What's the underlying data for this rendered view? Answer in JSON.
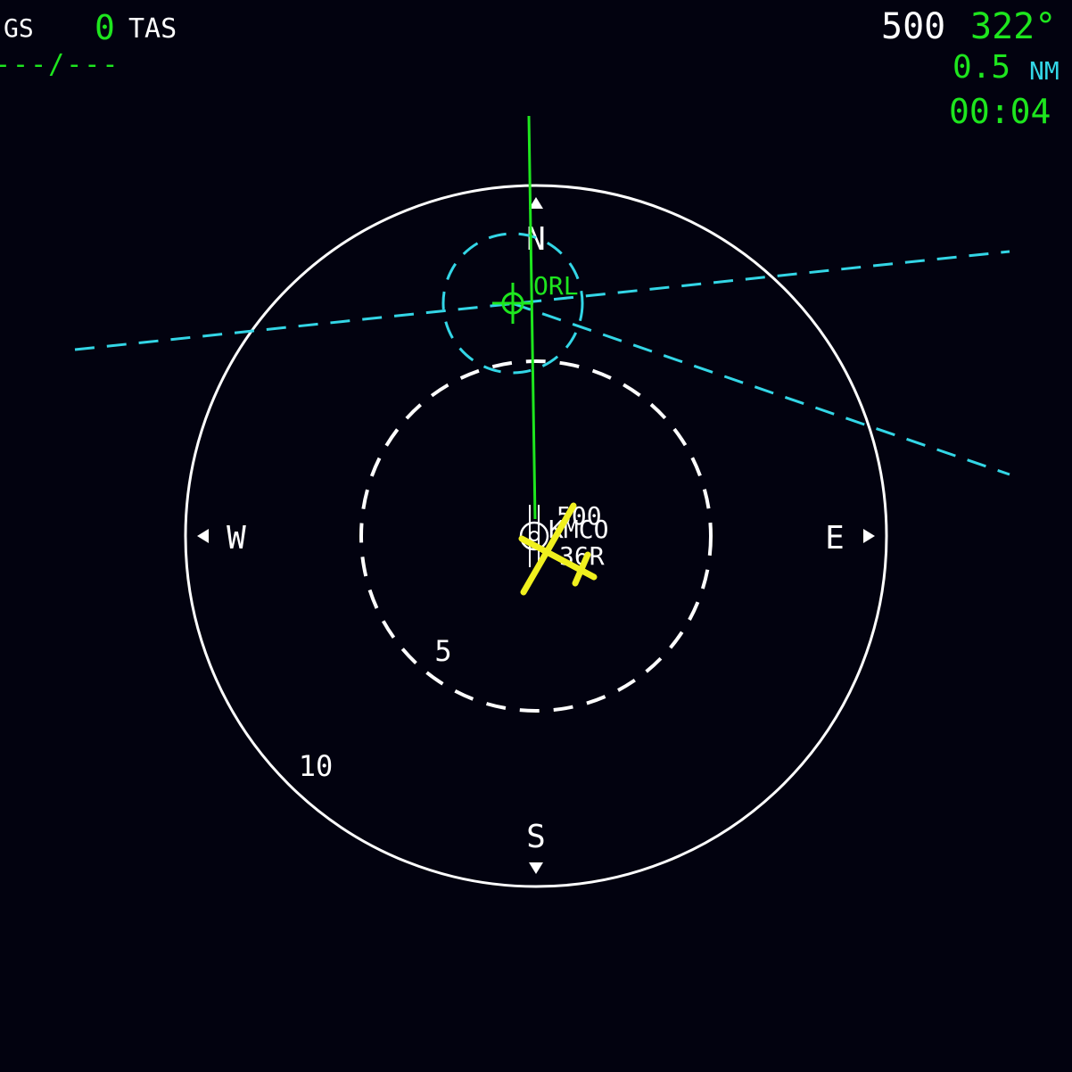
{
  "top_left": {
    "gs_label": "GS",
    "tas_value": "0",
    "tas_label": "TAS",
    "wind": "---/---"
  },
  "top_right": {
    "altitude": "500",
    "heading": "322°",
    "distance_value": "0.5",
    "distance_unit": "NM",
    "time": "00:04"
  },
  "compass": {
    "north": "N",
    "south": "S",
    "east": "E",
    "west": "W"
  },
  "range_rings": {
    "inner": "5",
    "outer": "10"
  },
  "waypoint": {
    "ident": "ORL"
  },
  "airport": {
    "alt": "500",
    "ident": "KMCO",
    "runway": "36R"
  },
  "colors": {
    "background": "#02020f",
    "white": "#ffffff",
    "green": "#1ee61e",
    "cyan": "#33d6e6",
    "yellow": "#f0f01e"
  }
}
